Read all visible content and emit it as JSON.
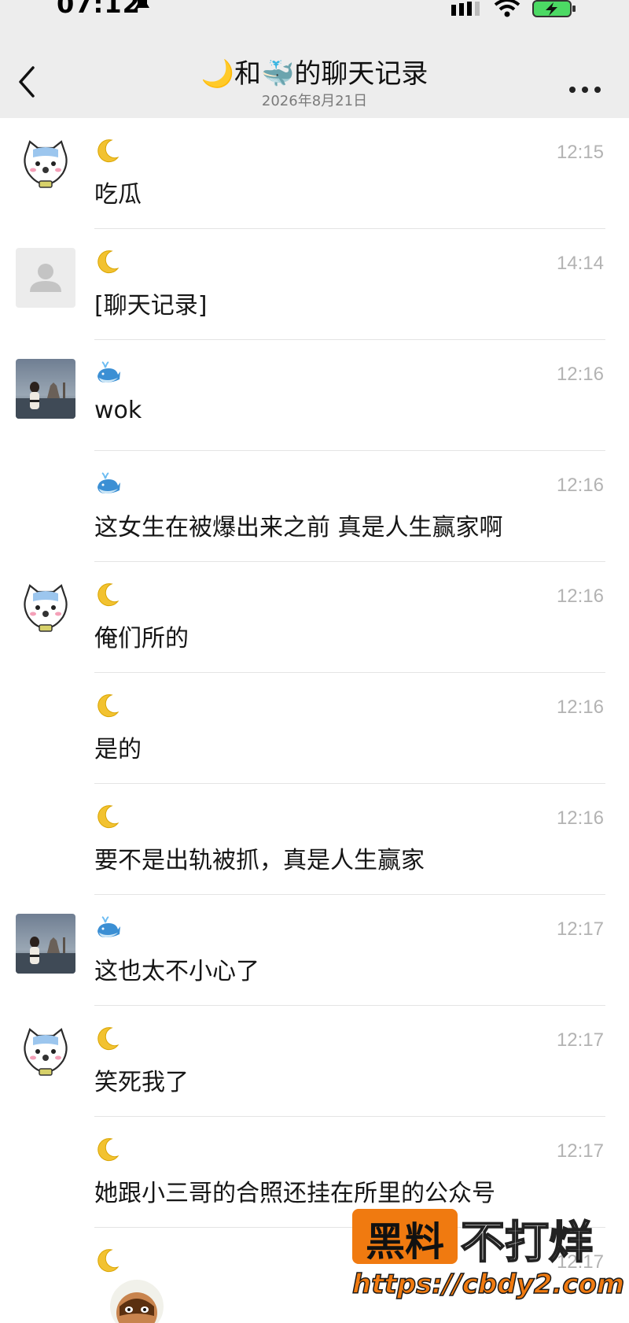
{
  "status_bar": {
    "time": "07:12",
    "icons": [
      "bell-muted-icon",
      "signal-icon",
      "wifi-icon",
      "battery-charging-icon"
    ]
  },
  "nav": {
    "title": "🌙和🐳的聊天记录",
    "subtitle": "2026年8月21日",
    "back_icon": "chevron-left-icon",
    "more_icon": "ellipsis-icon"
  },
  "messages": [
    {
      "avatar": "cartoon-cat",
      "sender": "moon",
      "time": "12:15",
      "text": "吃瓜"
    },
    {
      "avatar": "default-user",
      "sender": "moon",
      "time": "14:14",
      "text": "[聊天记录]"
    },
    {
      "avatar": "photo-woman",
      "sender": "whale",
      "time": "12:16",
      "text": "wok"
    },
    {
      "avatar": "none",
      "sender": "whale",
      "time": "12:16",
      "text": "这女生在被爆出来之前 真是人生赢家啊"
    },
    {
      "avatar": "cartoon-cat",
      "sender": "moon",
      "time": "12:16",
      "text": "俺们所的"
    },
    {
      "avatar": "none",
      "sender": "moon",
      "time": "12:16",
      "text": "是的"
    },
    {
      "avatar": "none",
      "sender": "moon",
      "time": "12:16",
      "text": "要不是出轨被抓，真是人生赢家"
    },
    {
      "avatar": "photo-woman",
      "sender": "whale",
      "time": "12:17",
      "text": "这也太不小心了"
    },
    {
      "avatar": "cartoon-cat",
      "sender": "moon",
      "time": "12:17",
      "text": "笑死我了"
    },
    {
      "avatar": "none",
      "sender": "moon",
      "time": "12:17",
      "text": "她跟小三哥的合照还挂在所里的公众号"
    },
    {
      "avatar": "none",
      "sender": "moon",
      "time": "12:17",
      "text": ""
    }
  ],
  "watermark": {
    "main": "黑料",
    "side": "不打烊",
    "url": "https://cbdy2.com"
  },
  "colors": {
    "header_bg": "#ededed",
    "time_gray": "#b3b3b3",
    "watermark_orange": "#f07a10"
  }
}
